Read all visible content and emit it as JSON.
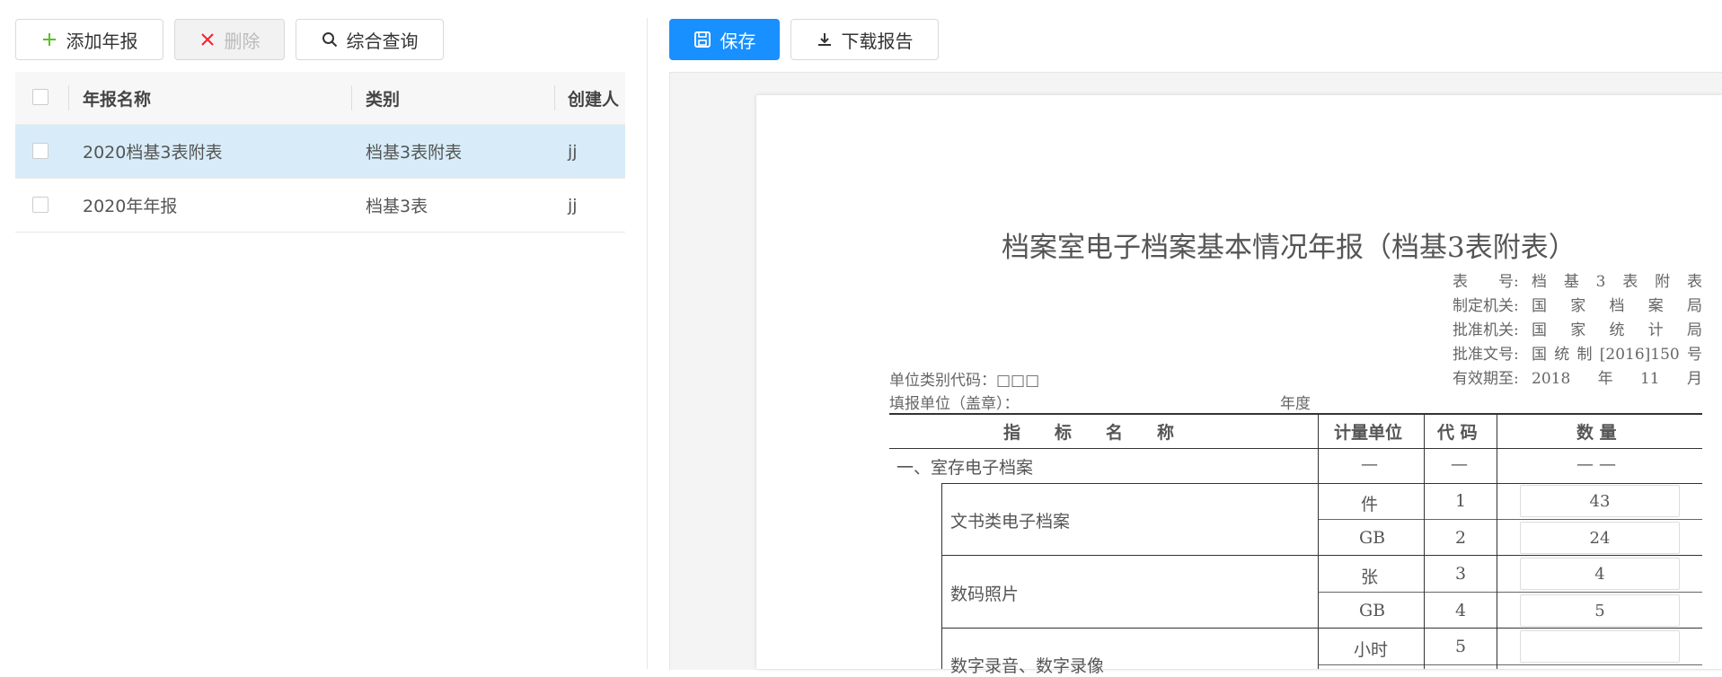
{
  "toolbar_left": {
    "add_label": "添加年报",
    "delete_label": "删除",
    "query_label": "综合查询"
  },
  "toolbar_right": {
    "save_label": "保存",
    "download_label": "下载报告"
  },
  "grid": {
    "columns": [
      "年报名称",
      "类别",
      "创建人"
    ],
    "rows": [
      {
        "name": "2020档基3表附表",
        "category": "档基3表附表",
        "creator": "jj",
        "selected": true
      },
      {
        "name": "2020年年报",
        "category": "档基3表",
        "creator": "jj",
        "selected": false
      }
    ]
  },
  "report": {
    "title": "档案室电子档案基本情况年报（档基3表附表）",
    "meta": [
      {
        "key": "表　　号:",
        "value": "档基3表附表"
      },
      {
        "key": "制定机关:",
        "value": "国家档案局"
      },
      {
        "key": "批准机关:",
        "value": "国家统计局"
      },
      {
        "key": "批准文号:",
        "value": "国统制[2016]150号"
      },
      {
        "key": "有效期至:",
        "value": "2018　年　11　月"
      }
    ],
    "unit_code": "单位类别代码：□□□",
    "fill_unit": "填报单位（盖章）：",
    "year_label": "年度",
    "headers": {
      "name": "指　　标　　名　　称",
      "unit": "计量单位",
      "code": "代 码",
      "qty": "数 量"
    },
    "section1": {
      "name": "一、室存电子档案",
      "unit": "—",
      "code": "—",
      "qty": "— —"
    },
    "items": [
      {
        "name": "文书类电子档案",
        "rows": [
          {
            "unit": "件",
            "code": "1",
            "qty": "43"
          },
          {
            "unit": "GB",
            "code": "2",
            "qty": "24"
          }
        ]
      },
      {
        "name": "数码照片",
        "rows": [
          {
            "unit": "张",
            "code": "3",
            "qty": "4"
          },
          {
            "unit": "GB",
            "code": "4",
            "qty": "5"
          }
        ]
      },
      {
        "name": "数字录音、数字录像",
        "rows": [
          {
            "unit": "小时",
            "code": "5",
            "qty": ""
          }
        ]
      }
    ]
  },
  "colors": {
    "primary": "#1890ff",
    "selected_row": "#d7ecf8",
    "add_icon": "#52c41a",
    "delete_icon": "#f5222d"
  }
}
